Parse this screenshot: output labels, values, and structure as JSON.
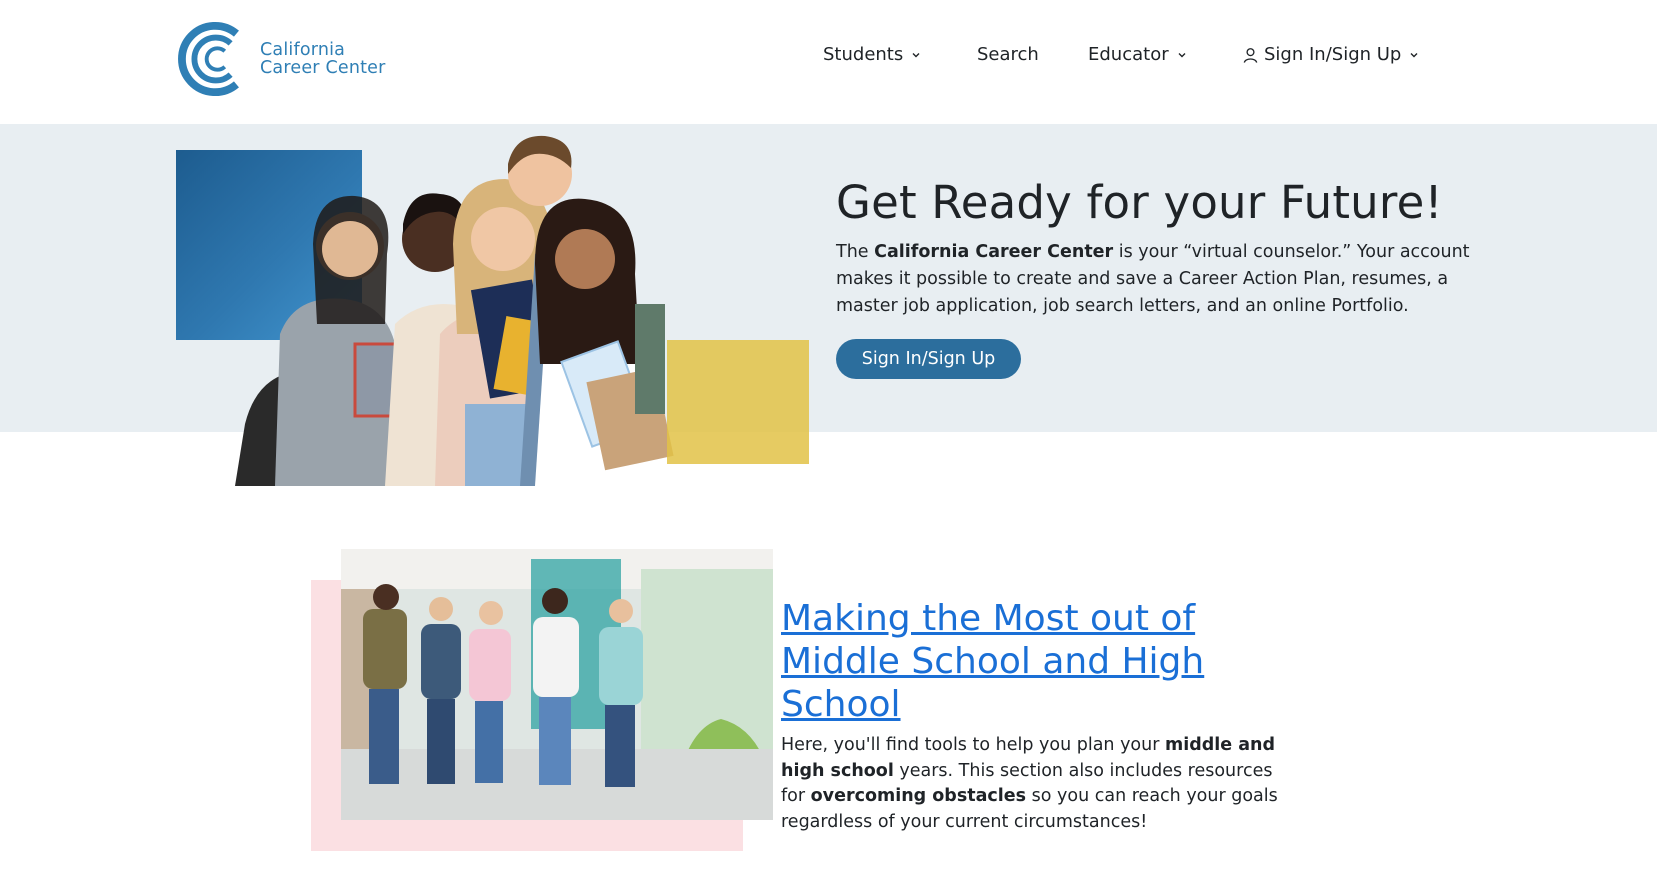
{
  "brand": {
    "line1": "California",
    "line2": "Career Center",
    "color": "#2f7fb5"
  },
  "nav": {
    "students": "Students",
    "search": "Search",
    "educator": "Educator",
    "signin": "Sign In/Sign Up"
  },
  "hero": {
    "title": "Get Ready for your Future!",
    "body_pre": "The ",
    "body_bold": "California Career Center",
    "body_post": " is your “virtual counselor.” Your account makes it possible to create and save a Career Action Plan, resumes, a master job application, job search letters, and an online Portfolio.",
    "button": "Sign In/Sign Up",
    "band_color": "#e8eef2",
    "button_color": "#2c6e9d"
  },
  "section": {
    "title": "Making the Most out of Middle School and High School",
    "body_1": "Here, you'll find tools to help you plan your ",
    "body_bold_1": "middle and high school",
    "body_2": " years. This section also includes resources for ",
    "body_bold_2": "overcoming obstacles",
    "body_3": " so you can reach your goals regardless of your current circumstances!",
    "link_color": "#1a6fd6"
  },
  "icons": {
    "logo": "career-center-logo-icon",
    "chevron": "chevron-down-icon",
    "user": "user-icon"
  }
}
